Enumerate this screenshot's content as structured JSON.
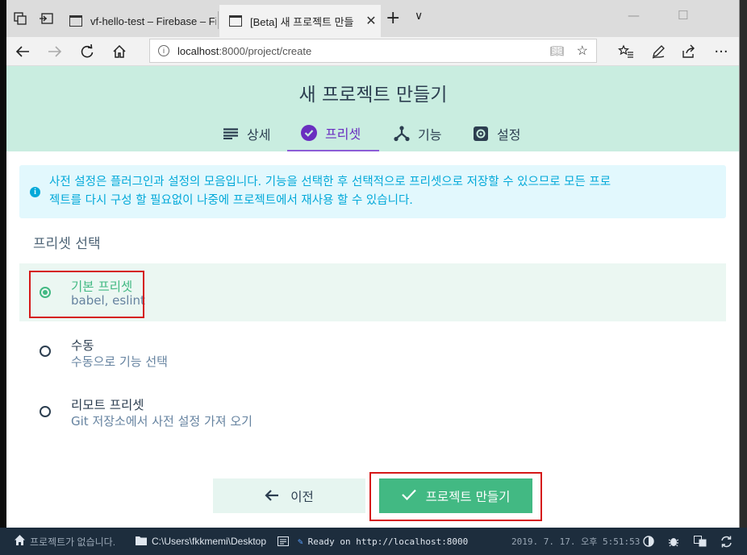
{
  "browser": {
    "tabs": [
      {
        "title": "vf-hello-test – Firebase – Fir",
        "active": false
      },
      {
        "title": "[Beta] 새 프로젝트 만들",
        "active": true
      }
    ],
    "new_tab": "+",
    "tab_dropdown": "∨",
    "url": {
      "host": "localhost",
      "path": ":8000/project/create"
    },
    "icons": [
      "back-icon",
      "forward-icon",
      "refresh-icon",
      "home-icon",
      "reading-view-icon",
      "favorite-icon",
      "favorites-hub-icon",
      "pen-icon",
      "share-icon",
      "more-icon"
    ]
  },
  "page": {
    "title": "새 프로젝트 만들기",
    "tabs": [
      {
        "label": "상세",
        "icon": "details-list-icon"
      },
      {
        "label": "프리셋",
        "icon": "check-circle-icon",
        "selected": true
      },
      {
        "label": "기능",
        "icon": "features-fork-icon"
      },
      {
        "label": "설정",
        "icon": "settings-gear-icon"
      }
    ],
    "notice": {
      "line1": "사전 설정은 플러그인과 설정의 모음입니다. 기능을 선택한 후 선택적으로 프리셋으로 저장할 수 있으므로 모든 프로",
      "line2": "젝트를 다시 구성 할 필요없이 나중에 프로젝트에서 재사용 할 수 있습니다."
    },
    "section_title": "프리셋 선택",
    "options": [
      {
        "name": "기본 프리셋",
        "description": "babel, eslint",
        "selected": true
      },
      {
        "name": "수동",
        "description": "수동으로 기능 선택",
        "selected": false
      },
      {
        "name": "리모트 프리셋",
        "description": "Git 저장소에서 사전 설정 가져 오기",
        "selected": false
      }
    ],
    "prev_button": "이전",
    "create_button": "프로젝트 만들기"
  },
  "statusbar": {
    "project": "프로젝트가 없습니다.",
    "path": "C:\\Users\\fkkmemi\\Desktop",
    "server": "Ready on http://localhost:8000",
    "timestamp": "2019. 7. 17. 오후 5:51:53"
  },
  "colors": {
    "accent": "#42b983",
    "header_bg": "#c9ede0",
    "tab_selected": "#6a2ec0",
    "notice_text": "#03a9d9",
    "statusbar_bg": "#1d2d3d",
    "highlight_box": "#d51818"
  }
}
